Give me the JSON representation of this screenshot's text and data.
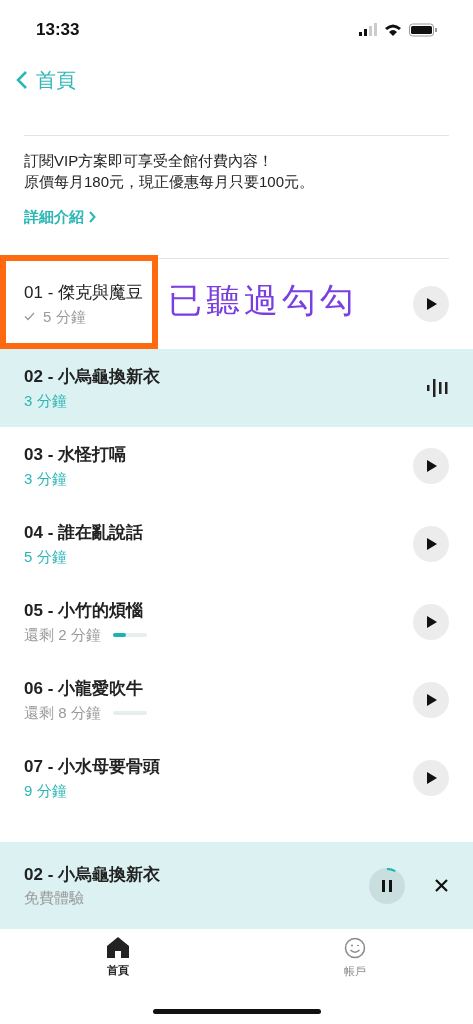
{
  "status_bar": {
    "time": "13:33"
  },
  "header": {
    "back_label": "首頁"
  },
  "promo": {
    "lines": [
      "訂閱VIP方案即可享受全館付費內容！",
      "原價每月180元，現正優惠每月只要100元。"
    ],
    "link": "詳細介紹"
  },
  "episodes": [
    {
      "title": "01 - 傑克與魔豆",
      "duration": "5 分鐘",
      "kind": "played",
      "selected": false,
      "annotation": "已聽過勾勾"
    },
    {
      "title": "02 - 小烏龜換新衣",
      "duration": "3 分鐘",
      "kind": "playing",
      "selected": true
    },
    {
      "title": "03 - 水怪打嗝",
      "duration": "3 分鐘",
      "kind": "new",
      "selected": false
    },
    {
      "title": "04 - 誰在亂說話",
      "duration": "5 分鐘",
      "kind": "new",
      "selected": false
    },
    {
      "title": "05 - 小竹的煩惱",
      "duration": "還剩 2 分鐘",
      "kind": "partial",
      "selected": false,
      "level": 0.4
    },
    {
      "title": "06 - 小龍愛吹牛",
      "duration": "還剩 8 分鐘",
      "kind": "partial",
      "selected": false
    },
    {
      "title": "07 - 小水母要骨頭",
      "duration": "9 分鐘",
      "kind": "new",
      "selected": false
    }
  ],
  "mini_player": {
    "title": "02 - 小烏龜換新衣",
    "subtitle": "免費體驗"
  },
  "tab_bar": [
    {
      "label": "首頁",
      "selected": true,
      "kind": "home"
    },
    {
      "label": "帳戶",
      "selected": false,
      "kind": "account"
    }
  ]
}
